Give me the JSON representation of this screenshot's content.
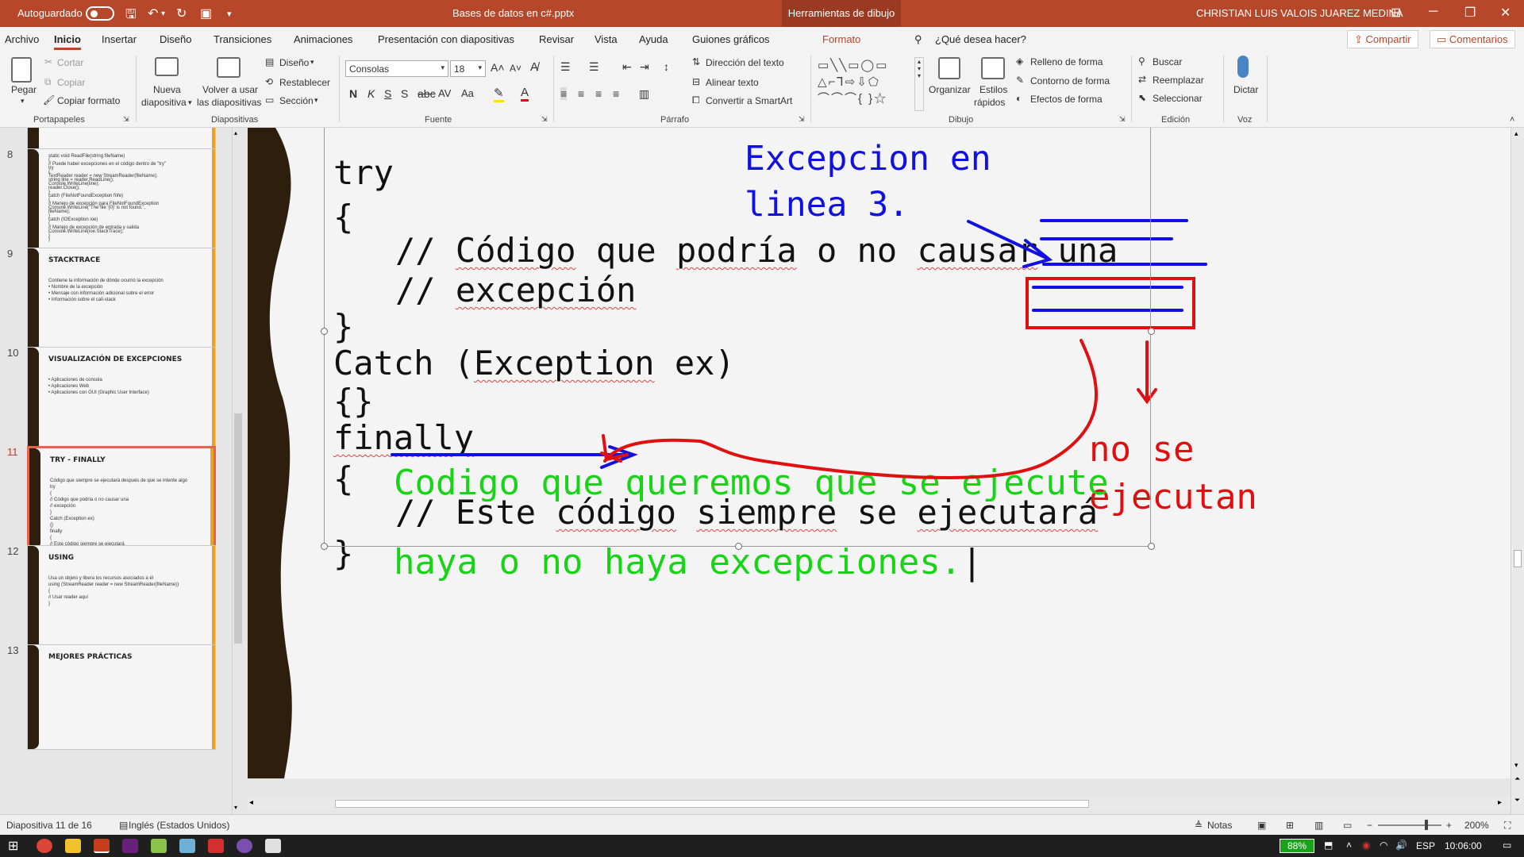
{
  "titlebar": {
    "autosave": "Autoguardado",
    "filename": "Bases de datos en c#.pptx",
    "contextual": "Herramientas de dibujo",
    "user": "CHRISTIAN LUIS VALOIS JUAREZ MEDINA"
  },
  "menu": {
    "tabs": [
      "Archivo",
      "Inicio",
      "Insertar",
      "Diseño",
      "Transiciones",
      "Animaciones",
      "Presentación con diapositivas",
      "Revisar",
      "Vista",
      "Ayuda",
      "Guiones gráficos",
      "Formato"
    ],
    "search": "¿Qué desea hacer?",
    "share": "Compartir",
    "comments": "Comentarios"
  },
  "ribbon": {
    "portapapeles": {
      "pegar": "Pegar",
      "cortar": "Cortar",
      "copiar": "Copiar",
      "copiar_formato": "Copiar formato",
      "label": "Portapapeles"
    },
    "diapositivas": {
      "nueva": "Nueva",
      "nueva2": "diapositiva",
      "volver": "Volver a usar",
      "volver2": "las diapositivas",
      "diseno": "Diseño",
      "restablecer": "Restablecer",
      "seccion": "Sección",
      "label": "Diapositivas"
    },
    "fuente": {
      "font": "Consolas",
      "size": "18",
      "label": "Fuente"
    },
    "parrafo": {
      "direccion": "Dirección del texto",
      "alinear": "Alinear texto",
      "convertir": "Convertir a SmartArt",
      "label": "Párrafo"
    },
    "dibujo": {
      "organizar": "Organizar",
      "estilos": "Estilos",
      "estilos2": "rápidos",
      "relleno": "Relleno de forma",
      "contorno": "Contorno de forma",
      "efectos": "Efectos de forma",
      "label": "Dibujo"
    },
    "edicion": {
      "buscar": "Buscar",
      "reemplazar": "Reemplazar",
      "seleccionar": "Seleccionar",
      "label": "Edición"
    },
    "voz": {
      "dictar": "Dictar",
      "label": "Voz"
    }
  },
  "thumbnails": [
    {
      "num": "8",
      "title": "",
      "lines": [
        "static void ReadFile(string fileName)",
        "{",
        "// Puede haber excepciones en el código dentro de \"try\"",
        "try",
        "{",
        "TextReader reader = new StreamReader(fileName);",
        "string line = reader.ReadLine();",
        "Console.WriteLine(line);",
        "reader.Close();",
        "}",
        "catch (FileNotFoundException fnfe)",
        "{",
        "// Manejo de excepción para FileNotFoundException",
        "Console.WriteLine(\"The file '{0}' is not found.\",",
        "fileName);",
        "}",
        "catch (IOException ioe)",
        "{",
        "// Manejo de excepción de entrada y salida",
        "Console.WriteLine(ioe.StackTrace);",
        "}",
        "}"
      ]
    },
    {
      "num": "9",
      "title": "STACKTRACE",
      "lines": [
        "Contiene la información de dónde ocurrió la excepción",
        "• Nombre de la excepción",
        "• Mensaje con información adicional sobre el error",
        "• Información sobre el call-stack"
      ]
    },
    {
      "num": "10",
      "title": "VISUALIZACIÓN DE EXCEPCIONES",
      "lines": [
        "• Aplicaciones de consola",
        "• Aplicaciones Web",
        "• Aplicaciones con GUI (Graphic User Interface)"
      ]
    },
    {
      "num": "11",
      "title": "TRY - FINALLY",
      "lines": [
        "Código que siempre se ejecutará después de que se intente algo",
        "try",
        "{",
        "// Código que podría o no causar una",
        "// excepción",
        "}",
        "Catch (Exception ex)",
        "{}",
        "finally",
        "{",
        "// Este código siempre se ejecutará",
        "}"
      ]
    },
    {
      "num": "12",
      "title": "USING",
      "lines": [
        "Usa un objeto y libera los recursos asociados a él",
        "using (StreamReader reader = new StreamReader(fileName))",
        "{",
        "// Usar reader aquí",
        "}"
      ]
    },
    {
      "num": "13",
      "title": "MEJORES PRÁCTICAS",
      "lines": []
    }
  ],
  "slide": {
    "code": {
      "try": "try",
      "open1": "{",
      "comment1_a": "// ",
      "comment1_b": "Código",
      "comment1_c": " que ",
      "comment1_d": "podría",
      "comment1_e": " o no ",
      "comment1_f": "causar",
      "comment1_g": " una",
      "comment2_a": "// ",
      "comment2_b": "excepción",
      "close1": "}",
      "catch_a": "Catch (",
      "catch_b": "Exception",
      "catch_c": " ex)",
      "empty": "{}",
      "finally": "finally",
      "open2": "{",
      "comment3_a": "// Este ",
      "comment3_b": "código",
      "comment3_c": " ",
      "comment3_d": "siempre",
      "comment3_e": " se ",
      "comment3_f": "ejecutará",
      "close2": "}"
    },
    "annotations": {
      "blue_1": "Excepcion en",
      "blue_2": "linea 3.",
      "red_1": "no se",
      "red_2": "ejecutan",
      "green_1": "Codigo que queremos que se ejecute",
      "green_2": "haya o no haya excepciones."
    }
  },
  "status": {
    "slide": "Diapositiva 11 de 16",
    "language": "Inglés (Estados Unidos)",
    "notes": "Notas",
    "zoom": "200%"
  },
  "taskbar": {
    "battery": "88%",
    "lang": "ESP",
    "time": "10:06:00"
  },
  "colors": {
    "accent": "#b7472a",
    "annotation_blue": "#1010e0",
    "annotation_red": "#e01010",
    "annotation_green": "#17d417"
  }
}
